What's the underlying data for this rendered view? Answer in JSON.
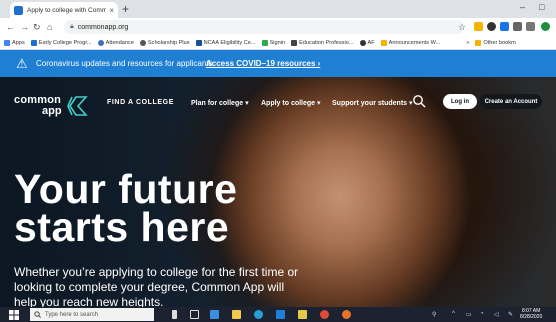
{
  "browser": {
    "tab_title": "Apply to college with Common A",
    "tab_close": "×",
    "new_tab": "+",
    "url": "commonapp.org",
    "window_minimize": "–",
    "window_maximize": "□"
  },
  "bookmarks": {
    "items": [
      {
        "label": "Apps",
        "color": "#4285f4"
      },
      {
        "label": "Early College Progr...",
        "color": "#1f6fd1"
      },
      {
        "label": "Attendance",
        "color": "#3b6fc8"
      },
      {
        "label": "Scholarship Plus",
        "color": "#555555"
      },
      {
        "label": "NCAA Eligibility Ce...",
        "color": "#1a4f9a"
      },
      {
        "label": "Signin",
        "color": "#2fa84f"
      },
      {
        "label": "Education Professio...",
        "color": "#444444"
      },
      {
        "label": "AF",
        "color": "#333333"
      },
      {
        "label": "Announcements W...",
        "color": "#f4b400"
      }
    ],
    "more": "»",
    "other": "Other bookm"
  },
  "banner": {
    "text": "Coronavirus updates and resources for applicants",
    "link": "Access COVID–19 resources ›"
  },
  "header": {
    "logo_line1": "common",
    "logo_line2": "app",
    "find_college": "FIND A COLLEGE",
    "nav": [
      {
        "label": "Plan for college ▾"
      },
      {
        "label": "Apply to college ▾"
      },
      {
        "label": "Support your students ▾"
      }
    ],
    "login": "Log in",
    "create_account": "Create an Account"
  },
  "hero": {
    "headline_line1": "Your future",
    "headline_line2": "starts here",
    "subtext": "Whether you’re applying to college for the first time or looking to complete your degree, Common App will help you reach new heights."
  },
  "taskbar": {
    "search_placeholder": "Type here to search",
    "time": "8:07 AM",
    "date": "8/28/2020"
  },
  "colors": {
    "banner": "#1f7fd3",
    "accent_teal": "#3fd1c7"
  }
}
